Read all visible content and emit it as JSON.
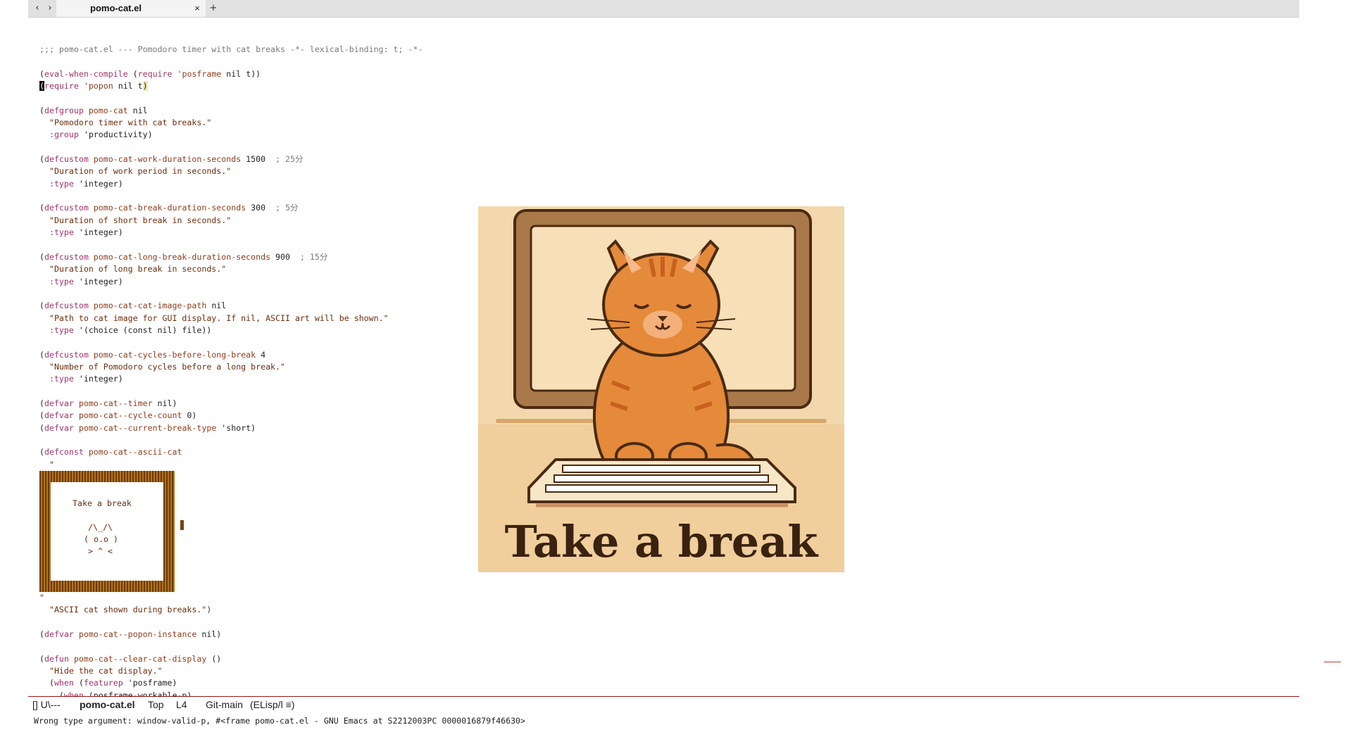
{
  "tabbar": {
    "back_glyph": "‹",
    "forward_glyph": "›",
    "active_tab": "pomo-cat.el",
    "close_glyph": "×",
    "new_tab_glyph": "+"
  },
  "code_lines": [
    [
      {
        "t": ";;; pomo-cat.el --- Pomodoro timer with cat breaks -*- lexical-binding: t; -*-",
        "c": "cmt"
      }
    ],
    [],
    [
      {
        "t": "(",
        "c": "plain"
      },
      {
        "t": "eval-when-compile",
        "c": "kw"
      },
      {
        "t": " (",
        "c": "plain"
      },
      {
        "t": "require",
        "c": "kw"
      },
      {
        "t": " ",
        "c": "plain"
      },
      {
        "t": "'posframe",
        "c": "fn"
      },
      {
        "t": " nil t))",
        "c": "plain"
      }
    ],
    [
      {
        "t": "(",
        "c": "cursor"
      },
      {
        "t": "require",
        "c": "kw"
      },
      {
        "t": " ",
        "c": "plain"
      },
      {
        "t": "'popon",
        "c": "fn"
      },
      {
        "t": " nil t",
        "c": "plain"
      },
      {
        "t": ")",
        "c": "paren-hl"
      }
    ],
    [],
    [
      {
        "t": "(",
        "c": "plain"
      },
      {
        "t": "defgroup",
        "c": "kw"
      },
      {
        "t": " ",
        "c": "plain"
      },
      {
        "t": "pomo-cat",
        "c": "fn"
      },
      {
        "t": " nil",
        "c": "plain"
      }
    ],
    [
      {
        "t": "  \"Pomodoro timer with cat breaks.\"",
        "c": "str"
      }
    ],
    [
      {
        "t": "  ",
        "c": "plain"
      },
      {
        "t": ":group",
        "c": "kw"
      },
      {
        "t": " 'productivity)",
        "c": "plain"
      }
    ],
    [],
    [
      {
        "t": "(",
        "c": "plain"
      },
      {
        "t": "defcustom",
        "c": "kw"
      },
      {
        "t": " ",
        "c": "plain"
      },
      {
        "t": "pomo-cat-work-duration-seconds",
        "c": "fn"
      },
      {
        "t": " 1500  ",
        "c": "plain"
      },
      {
        "t": "; 25分",
        "c": "cmt"
      }
    ],
    [
      {
        "t": "  \"Duration of work period in seconds.\"",
        "c": "str"
      }
    ],
    [
      {
        "t": "  ",
        "c": "plain"
      },
      {
        "t": ":type",
        "c": "kw"
      },
      {
        "t": " 'integer)",
        "c": "plain"
      }
    ],
    [],
    [
      {
        "t": "(",
        "c": "plain"
      },
      {
        "t": "defcustom",
        "c": "kw"
      },
      {
        "t": " ",
        "c": "plain"
      },
      {
        "t": "pomo-cat-break-duration-seconds",
        "c": "fn"
      },
      {
        "t": " 300  ",
        "c": "plain"
      },
      {
        "t": "; 5分",
        "c": "cmt"
      }
    ],
    [
      {
        "t": "  \"Duration of short break in seconds.\"",
        "c": "str"
      }
    ],
    [
      {
        "t": "  ",
        "c": "plain"
      },
      {
        "t": ":type",
        "c": "kw"
      },
      {
        "t": " 'integer)",
        "c": "plain"
      }
    ],
    [],
    [
      {
        "t": "(",
        "c": "plain"
      },
      {
        "t": "defcustom",
        "c": "kw"
      },
      {
        "t": " ",
        "c": "plain"
      },
      {
        "t": "pomo-cat-long-break-duration-seconds",
        "c": "fn"
      },
      {
        "t": " 900  ",
        "c": "plain"
      },
      {
        "t": "; 15分",
        "c": "cmt"
      }
    ],
    [
      {
        "t": "  \"Duration of long break in seconds.\"",
        "c": "str"
      }
    ],
    [
      {
        "t": "  ",
        "c": "plain"
      },
      {
        "t": ":type",
        "c": "kw"
      },
      {
        "t": " 'integer)",
        "c": "plain"
      }
    ],
    [],
    [
      {
        "t": "(",
        "c": "plain"
      },
      {
        "t": "defcustom",
        "c": "kw"
      },
      {
        "t": " ",
        "c": "plain"
      },
      {
        "t": "pomo-cat-cat-image-path",
        "c": "fn"
      },
      {
        "t": " nil",
        "c": "plain"
      }
    ],
    [
      {
        "t": "  \"Path to cat image for GUI display. If nil, ASCII art will be shown.\"",
        "c": "str"
      }
    ],
    [
      {
        "t": "  ",
        "c": "plain"
      },
      {
        "t": ":type",
        "c": "kw"
      },
      {
        "t": " '(choice (const nil) file))",
        "c": "plain"
      }
    ],
    [],
    [
      {
        "t": "(",
        "c": "plain"
      },
      {
        "t": "defcustom",
        "c": "kw"
      },
      {
        "t": " ",
        "c": "plain"
      },
      {
        "t": "pomo-cat-cycles-before-long-break",
        "c": "fn"
      },
      {
        "t": " 4",
        "c": "plain"
      }
    ],
    [
      {
        "t": "  \"Number of Pomodoro cycles before a long break.\"",
        "c": "str"
      }
    ],
    [
      {
        "t": "  ",
        "c": "plain"
      },
      {
        "t": ":type",
        "c": "kw"
      },
      {
        "t": " 'integer)",
        "c": "plain"
      }
    ],
    [],
    [
      {
        "t": "(",
        "c": "plain"
      },
      {
        "t": "defvar",
        "c": "kw"
      },
      {
        "t": " ",
        "c": "plain"
      },
      {
        "t": "pomo-cat--timer",
        "c": "fn"
      },
      {
        "t": " nil)",
        "c": "plain"
      }
    ],
    [
      {
        "t": "(",
        "c": "plain"
      },
      {
        "t": "defvar",
        "c": "kw"
      },
      {
        "t": " ",
        "c": "plain"
      },
      {
        "t": "pomo-cat--cycle-count",
        "c": "fn"
      },
      {
        "t": " 0)",
        "c": "plain"
      }
    ],
    [
      {
        "t": "(",
        "c": "plain"
      },
      {
        "t": "defvar",
        "c": "kw"
      },
      {
        "t": " ",
        "c": "plain"
      },
      {
        "t": "pomo-cat--current-break-type",
        "c": "fn"
      },
      {
        "t": " 'short)",
        "c": "plain"
      }
    ],
    [],
    [
      {
        "t": "(",
        "c": "plain"
      },
      {
        "t": "defconst",
        "c": "kw"
      },
      {
        "t": " ",
        "c": "plain"
      },
      {
        "t": "pomo-cat--ascii-cat",
        "c": "fn"
      }
    ],
    [
      {
        "t": "  \"",
        "c": "str"
      }
    ]
  ],
  "code_lines_after": [
    [
      {
        "t": "\"",
        "c": "str"
      }
    ],
    [
      {
        "t": "  \"ASCII cat shown during breaks.\")",
        "c": "str"
      }
    ],
    [],
    [
      {
        "t": "(",
        "c": "plain"
      },
      {
        "t": "defvar",
        "c": "kw"
      },
      {
        "t": " ",
        "c": "plain"
      },
      {
        "t": "pomo-cat--popon-instance",
        "c": "fn"
      },
      {
        "t": " nil)",
        "c": "plain"
      }
    ],
    [],
    [
      {
        "t": "(",
        "c": "plain"
      },
      {
        "t": "defun",
        "c": "kw"
      },
      {
        "t": " ",
        "c": "plain"
      },
      {
        "t": "pomo-cat--clear-cat-display",
        "c": "fn"
      },
      {
        "t": " ()",
        "c": "plain"
      }
    ],
    [
      {
        "t": "  \"Hide the cat display.\"",
        "c": "str"
      }
    ],
    [
      {
        "t": "  (",
        "c": "plain"
      },
      {
        "t": "when",
        "c": "kw"
      },
      {
        "t": " (",
        "c": "plain"
      },
      {
        "t": "featurep",
        "c": "kw"
      },
      {
        "t": " 'posframe)",
        "c": "plain"
      }
    ],
    [
      {
        "t": "    (",
        "c": "plain"
      },
      {
        "t": "when",
        "c": "kw"
      },
      {
        "t": " (posframe-workable-p)",
        "c": "plain"
      }
    ]
  ],
  "ascii_cat": {
    "title": "Take a break",
    "ears": "/\\_/\\",
    "face": "( o.o )",
    "whiskers": "> ^ <"
  },
  "cat_image": {
    "caption": "Take a break"
  },
  "modeline": {
    "status": "[] U\\---",
    "buffer_name": "pomo-cat.el",
    "position": "Top",
    "line": "L4",
    "vc": "Git-main",
    "mode": "(ELisp/l ≡)"
  },
  "echo_area": "Wrong type argument: window-valid-p, #<frame pomo-cat.el - GNU Emacs at S2212003PC 0000016879f46630>",
  "colors": {
    "keyword": "#a0356a",
    "function_name": "#8e3c1a",
    "string": "#6d2d0b",
    "comment": "#7a7a7a",
    "modeline_border": "#9a1515"
  }
}
